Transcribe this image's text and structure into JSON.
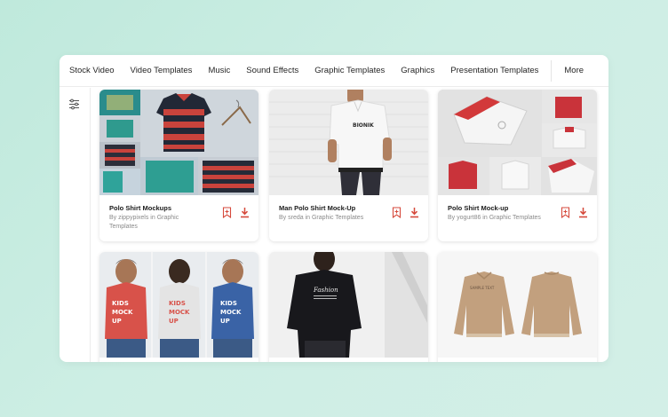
{
  "nav": {
    "items": [
      "Stock Video",
      "Video Templates",
      "Music",
      "Sound Effects",
      "Graphic Templates",
      "Graphics",
      "Presentation Templates"
    ],
    "more": "More"
  },
  "sidebar": {
    "filter_icon": "sliders-icon"
  },
  "colors": {
    "accent": "#d64a3c",
    "background": "#c8ece1"
  },
  "cards": [
    {
      "title": "Polo Shirt Mockups",
      "by": "By zippypixels in Graphic Templates"
    },
    {
      "title": "Man Polo Shirt Mock-Up",
      "by": "By sreda in Graphic Templates"
    },
    {
      "title": "Polo Shirt Mock-up",
      "by": "By yogurt86 in Graphic Templates"
    }
  ],
  "image_text": {
    "card2_logo": "BIONIK",
    "card4_shirt": [
      "KIDS",
      "MOCK",
      "UP"
    ],
    "card5_shirt": "Fashion",
    "card6_chest": "SAMPLE TEXT"
  }
}
